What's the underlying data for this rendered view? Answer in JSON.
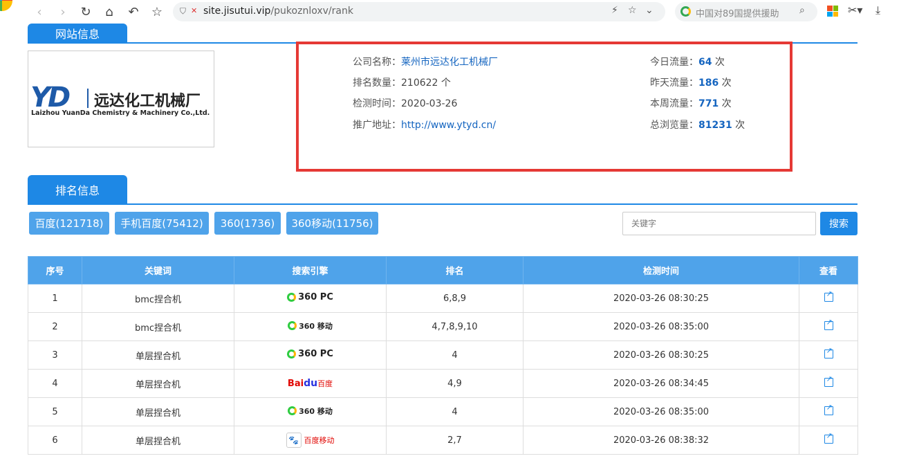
{
  "browser": {
    "url_host": "site.jisutui.vip",
    "url_path": "/pukoznloxv/rank",
    "search_placeholder": "中国对89国提供援助"
  },
  "site_info": {
    "tab_label": "网站信息",
    "left": [
      {
        "key": "公司名称：",
        "value": "莱州市远达化工机械厂",
        "type": "link"
      },
      {
        "key": "排名数量：",
        "value": "210622 个",
        "type": "text"
      },
      {
        "key": "检测时间：",
        "value": "2020-03-26",
        "type": "text"
      },
      {
        "key": "推广地址：",
        "value": "http://www.ytyd.cn/",
        "type": "link"
      }
    ],
    "right": [
      {
        "key": "今日流量：",
        "value": "64",
        "unit": " 次"
      },
      {
        "key": "昨天流量：",
        "value": "186",
        "unit": " 次"
      },
      {
        "key": "本周流量：",
        "value": "771",
        "unit": " 次"
      },
      {
        "key": "总浏览量：",
        "value": "81231",
        "unit": " 次"
      }
    ]
  },
  "company_logo": {
    "mark": "YD",
    "cn": "远达化工机械厂",
    "en": "Laizhou YuanDa Chemistry & Machinery  Co.,Ltd."
  },
  "rank_info": {
    "tab_label": "排名信息",
    "filters": [
      "百度(121718)",
      "手机百度(75412)",
      "360(1736)",
      "360移动(11756)"
    ],
    "keyword_placeholder": "关键字",
    "search_label": "搜索"
  },
  "table": {
    "headers": [
      "序号",
      "关键词",
      "搜索引擎",
      "排名",
      "检测时间",
      "查看"
    ],
    "rows": [
      {
        "no": "1",
        "keyword": "bmc捏合机",
        "engine": "360pc",
        "rank": "6,8,9",
        "time": "2020-03-26 08:30:25"
      },
      {
        "no": "2",
        "keyword": "bmc捏合机",
        "engine": "360m",
        "rank": "4,7,8,9,10",
        "time": "2020-03-26 08:35:00"
      },
      {
        "no": "3",
        "keyword": "单层捏合机",
        "engine": "360pc",
        "rank": "4",
        "time": "2020-03-26 08:30:25"
      },
      {
        "no": "4",
        "keyword": "单层捏合机",
        "engine": "baidu",
        "rank": "4,9",
        "time": "2020-03-26 08:34:45"
      },
      {
        "no": "5",
        "keyword": "单层捏合机",
        "engine": "360m",
        "rank": "4",
        "time": "2020-03-26 08:35:00"
      },
      {
        "no": "6",
        "keyword": "单层捏合机",
        "engine": "baidum",
        "rank": "2,7",
        "time": "2020-03-26 08:38:32"
      }
    ],
    "engine_labels": {
      "360pc": {
        "logo": "360 PC"
      },
      "360m": {
        "logo": "360",
        "sub": "移动"
      },
      "baidu": {
        "bai": "Bai",
        "paw": "du",
        "cn": "百度"
      },
      "baidum": {
        "cn": "百度移动"
      }
    }
  }
}
